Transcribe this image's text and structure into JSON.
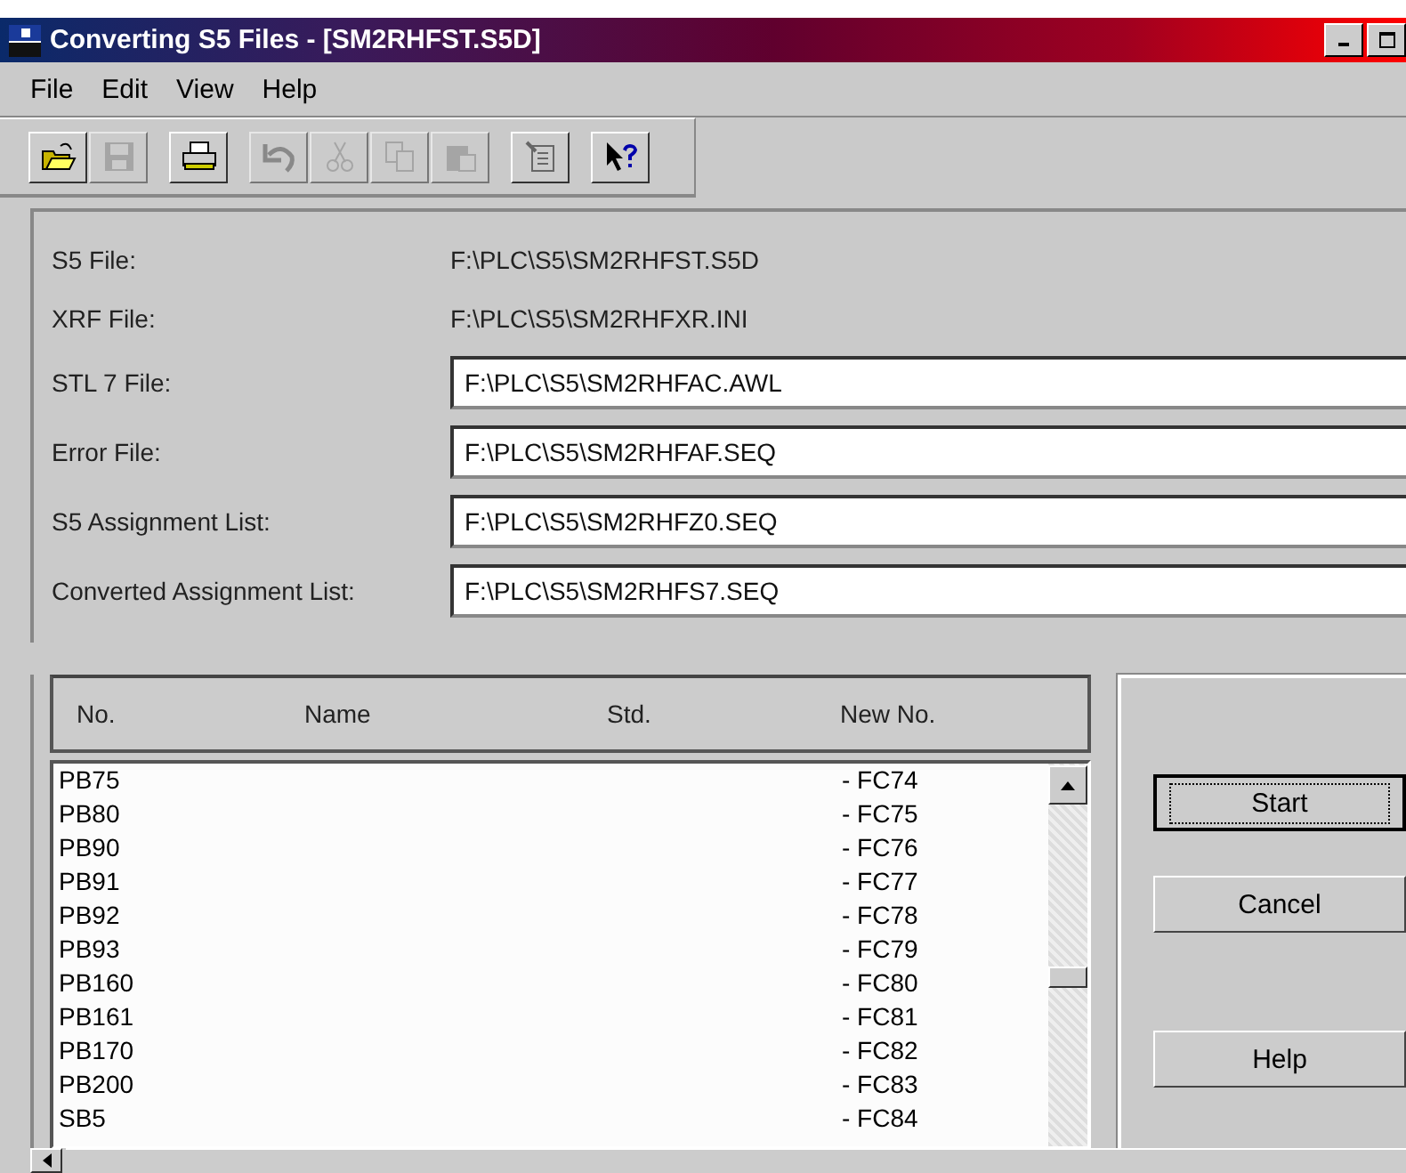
{
  "window": {
    "title": "Converting S5 Files - [SM2RHFST.S5D]"
  },
  "menu": [
    "File",
    "Edit",
    "View",
    "Help"
  ],
  "toolbar": [
    {
      "kind": "open",
      "disabled": false
    },
    {
      "kind": "save",
      "disabled": true
    },
    {
      "kind": "gap"
    },
    {
      "kind": "print",
      "disabled": false
    },
    {
      "kind": "gap"
    },
    {
      "kind": "undo",
      "disabled": true
    },
    {
      "kind": "cut",
      "disabled": true
    },
    {
      "kind": "copy",
      "disabled": true
    },
    {
      "kind": "paste",
      "disabled": true
    },
    {
      "kind": "gap"
    },
    {
      "kind": "properties",
      "disabled": false
    },
    {
      "kind": "gap"
    },
    {
      "kind": "whatsthis",
      "disabled": false
    }
  ],
  "files": [
    {
      "label": "S5 File:",
      "value": "F:\\PLC\\S5\\SM2RHFST.S5D",
      "kind": "text"
    },
    {
      "label": "XRF File:",
      "value": "F:\\PLC\\S5\\SM2RHFXR.INI",
      "kind": "text"
    },
    {
      "label": "STL 7 File:",
      "value": "F:\\PLC\\S5\\SM2RHFAC.AWL",
      "kind": "field"
    },
    {
      "label": "Error File:",
      "value": "F:\\PLC\\S5\\SM2RHFAF.SEQ",
      "kind": "field"
    },
    {
      "label": "S5 Assignment List:",
      "value": "F:\\PLC\\S5\\SM2RHFZ0.SEQ",
      "kind": "field"
    },
    {
      "label": "Converted Assignment List:",
      "value": "F:\\PLC\\S5\\SM2RHFS7.SEQ",
      "kind": "field"
    }
  ],
  "table": {
    "columns": [
      "No.",
      "Name",
      "Std.",
      "New No."
    ],
    "rows": [
      [
        "PB75",
        "- FC74"
      ],
      [
        "PB80",
        "- FC75"
      ],
      [
        "PB90",
        "- FC76"
      ],
      [
        "PB91",
        "- FC77"
      ],
      [
        "PB92",
        "- FC78"
      ],
      [
        "PB93",
        "- FC79"
      ],
      [
        "PB160",
        "- FC80"
      ],
      [
        "PB161",
        "- FC81"
      ],
      [
        "PB170",
        "- FC82"
      ],
      [
        "PB200",
        "- FC83"
      ],
      [
        "SB5",
        "- FC84"
      ]
    ]
  },
  "buttons": [
    {
      "label": "Start",
      "default": true
    },
    {
      "label": "Cancel",
      "default": false
    },
    {
      "label": "Help",
      "default": false
    }
  ]
}
